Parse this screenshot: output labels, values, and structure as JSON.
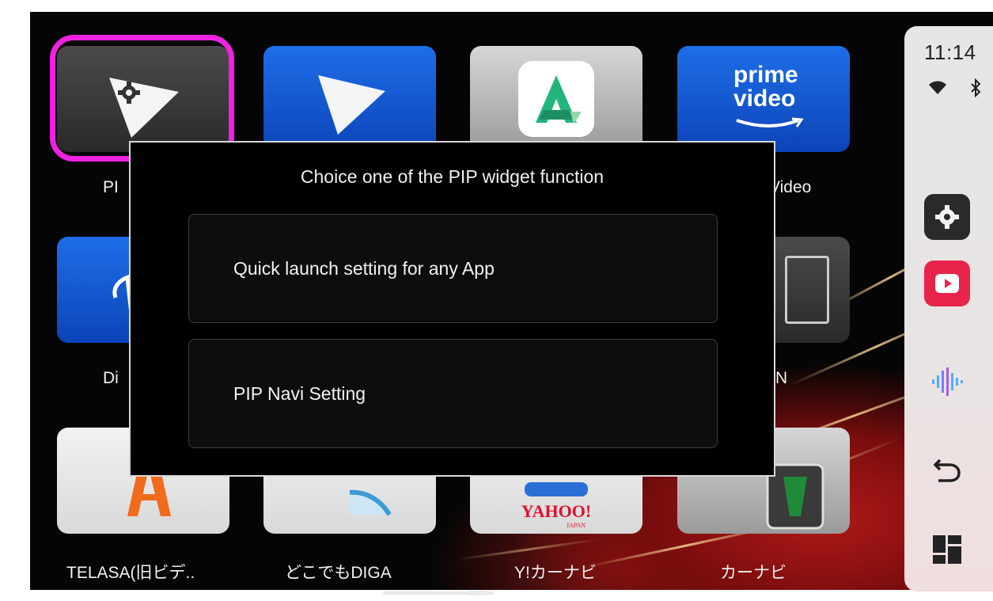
{
  "apps": [
    {
      "label": "PIP",
      "icon": "pip-navi-gear-icon"
    },
    {
      "label": "",
      "icon": "navigation-arrow-icon"
    },
    {
      "label": "",
      "icon": "apkpure-icon"
    },
    {
      "label": "Prime Video",
      "icon": "prime-video-icon",
      "icon_text_1": "prime",
      "icon_text_2": "video"
    },
    {
      "label": "Disney+",
      "icon": "disney-plus-icon"
    },
    {
      "label": "",
      "icon": "hidden-app-icon"
    },
    {
      "label": "",
      "icon": "hidden-app-icon"
    },
    {
      "label": "N",
      "icon": "app-icon"
    },
    {
      "label": "TELASA(旧ビデ..",
      "icon": "telasa-icon"
    },
    {
      "label": "どこでもDIGA",
      "icon": "diga-icon"
    },
    {
      "label": "Y!カーナビ",
      "icon": "yahoo-car-navi-icon",
      "icon_text_1": "YAHOO!",
      "icon_text_2": "JAPAN"
    },
    {
      "label": "カーナビ",
      "icon": "car-navi-icon"
    }
  ],
  "visible_partial_labels": {
    "pip": "PI",
    "prime_video": "Video",
    "disney": "Di",
    "row2_col4": "N"
  },
  "dialog": {
    "title": "Choice one of the PIP widget function",
    "options": [
      {
        "label": "Quick launch setting for any App"
      },
      {
        "label": "PIP Navi Setting"
      }
    ]
  },
  "status": {
    "time": "11:14",
    "wifi_icon": "wifi-icon",
    "bluetooth_icon": "bluetooth-icon"
  },
  "sidebar": {
    "items": [
      {
        "name": "settings",
        "icon": "gear-icon"
      },
      {
        "name": "youtube",
        "icon": "youtube-icon"
      },
      {
        "name": "voice",
        "icon": "voice-waveform-icon"
      },
      {
        "name": "back",
        "icon": "back-arrow-icon"
      },
      {
        "name": "recent",
        "icon": "split-screen-icon"
      }
    ]
  },
  "colors": {
    "highlight": "#ee22e0",
    "dialog_bg": "#000000",
    "sidebar_bg": "#e6e6e6"
  }
}
